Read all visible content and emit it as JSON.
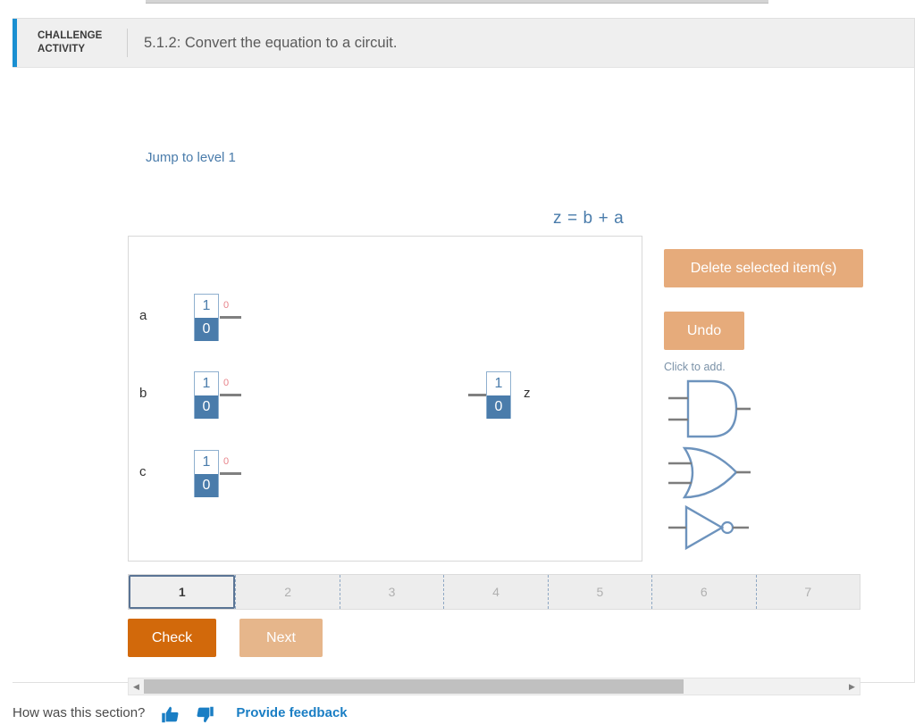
{
  "header": {
    "kicker": "CHALLENGE ACTIVITY",
    "title": "5.1.2: Convert the equation to a circuit.",
    "accent_color": "#1a8fd1"
  },
  "jump_to_level": {
    "label": "Jump to level 1"
  },
  "equation": {
    "text": "z = b + a"
  },
  "canvas": {
    "inputs": [
      {
        "name": "a",
        "top_value": "1",
        "bottom_value": "0",
        "readout": "0"
      },
      {
        "name": "b",
        "top_value": "1",
        "bottom_value": "0",
        "readout": "0"
      },
      {
        "name": "c",
        "top_value": "1",
        "bottom_value": "0",
        "readout": "0"
      }
    ],
    "outputs": [
      {
        "name": "z",
        "top_value": "1",
        "bottom_value": "0"
      }
    ]
  },
  "toolbar": {
    "delete_label": "Delete selected item(s)",
    "undo_label": "Undo",
    "click_to_add_label": "Click to add.",
    "disabled_color": "#e6ab7b",
    "gates": [
      {
        "type": "and-gate"
      },
      {
        "type": "or-gate"
      },
      {
        "type": "not-gate"
      }
    ]
  },
  "levels": {
    "active": "1",
    "tabs": [
      "1",
      "2",
      "3",
      "4",
      "5",
      "6",
      "7"
    ]
  },
  "actions": {
    "check_label": "Check",
    "check_color": "#d2690b",
    "next_label": "Next",
    "next_color": "#e6b68b"
  },
  "scrollbar": {
    "left_arrow": "◀",
    "right_arrow": "▶",
    "thumb_percent": "77"
  },
  "feedback": {
    "question": "How was this section?",
    "link_label": "Provide feedback",
    "link_color": "#1a7ec4"
  }
}
